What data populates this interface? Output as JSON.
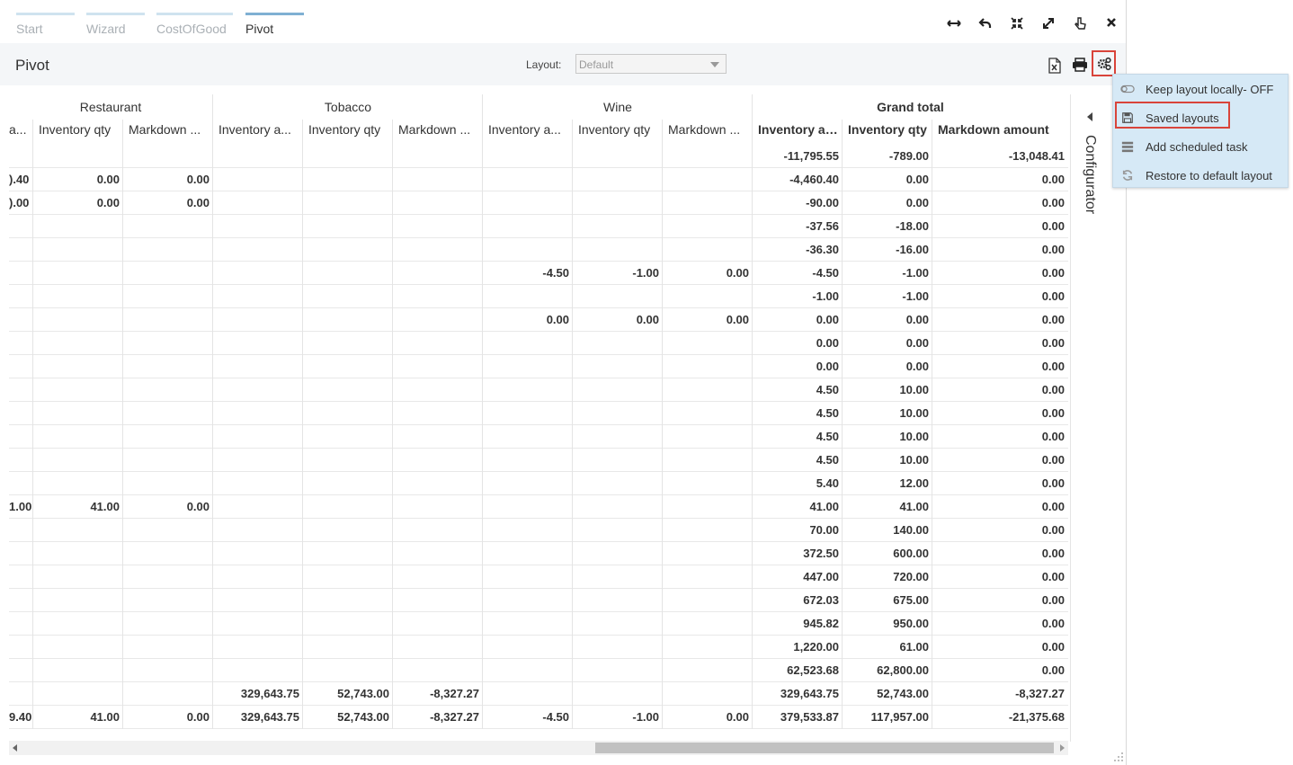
{
  "tabs": [
    {
      "label": "Start"
    },
    {
      "label": "Wizard"
    },
    {
      "label": "CostOfGood"
    },
    {
      "label": "Pivot"
    }
  ],
  "window_buttons": [
    "resize-horizontal-icon",
    "undo-icon",
    "shrink-icon",
    "expand-icon",
    "pointer-icon",
    "close-icon"
  ],
  "toolbar": {
    "title": "Pivot",
    "layout_label": "Layout:",
    "layout_value": "Default"
  },
  "columns": {
    "groups": [
      "Restaurant",
      "Tobacco",
      "Wine",
      "Grand total"
    ],
    "sub": [
      "a...",
      "Inventory qty",
      "Markdown ...",
      "Inventory a...",
      "Inventory qty",
      "Markdown ...",
      "Inventory a...",
      "Inventory qty",
      "Markdown ...",
      "Inventory amo",
      "Inventory qty",
      "Markdown amount"
    ]
  },
  "rows": [
    [
      "",
      "",
      "",
      "",
      "",
      "",
      "",
      "",
      "",
      "-11,795.55",
      "-789.00",
      "-13,048.41"
    ],
    [
      ").40",
      "0.00",
      "0.00",
      "",
      "",
      "",
      "",
      "",
      "",
      "-4,460.40",
      "0.00",
      "0.00"
    ],
    [
      ").00",
      "0.00",
      "0.00",
      "",
      "",
      "",
      "",
      "",
      "",
      "-90.00",
      "0.00",
      "0.00"
    ],
    [
      "",
      "",
      "",
      "",
      "",
      "",
      "",
      "",
      "",
      "-37.56",
      "-18.00",
      "0.00"
    ],
    [
      "",
      "",
      "",
      "",
      "",
      "",
      "",
      "",
      "",
      "-36.30",
      "-16.00",
      "0.00"
    ],
    [
      "",
      "",
      "",
      "",
      "",
      "",
      "-4.50",
      "-1.00",
      "0.00",
      "-4.50",
      "-1.00",
      "0.00"
    ],
    [
      "",
      "",
      "",
      "",
      "",
      "",
      "",
      "",
      "",
      "-1.00",
      "-1.00",
      "0.00"
    ],
    [
      "",
      "",
      "",
      "",
      "",
      "",
      "0.00",
      "0.00",
      "0.00",
      "0.00",
      "0.00",
      "0.00"
    ],
    [
      "",
      "",
      "",
      "",
      "",
      "",
      "",
      "",
      "",
      "0.00",
      "0.00",
      "0.00"
    ],
    [
      "",
      "",
      "",
      "",
      "",
      "",
      "",
      "",
      "",
      "0.00",
      "0.00",
      "0.00"
    ],
    [
      "",
      "",
      "",
      "",
      "",
      "",
      "",
      "",
      "",
      "4.50",
      "10.00",
      "0.00"
    ],
    [
      "",
      "",
      "",
      "",
      "",
      "",
      "",
      "",
      "",
      "4.50",
      "10.00",
      "0.00"
    ],
    [
      "",
      "",
      "",
      "",
      "",
      "",
      "",
      "",
      "",
      "4.50",
      "10.00",
      "0.00"
    ],
    [
      "",
      "",
      "",
      "",
      "",
      "",
      "",
      "",
      "",
      "4.50",
      "10.00",
      "0.00"
    ],
    [
      "",
      "",
      "",
      "",
      "",
      "",
      "",
      "",
      "",
      "5.40",
      "12.00",
      "0.00"
    ],
    [
      "1.00",
      "41.00",
      "0.00",
      "",
      "",
      "",
      "",
      "",
      "",
      "41.00",
      "41.00",
      "0.00"
    ],
    [
      "",
      "",
      "",
      "",
      "",
      "",
      "",
      "",
      "",
      "70.00",
      "140.00",
      "0.00"
    ],
    [
      "",
      "",
      "",
      "",
      "",
      "",
      "",
      "",
      "",
      "372.50",
      "600.00",
      "0.00"
    ],
    [
      "",
      "",
      "",
      "",
      "",
      "",
      "",
      "",
      "",
      "447.00",
      "720.00",
      "0.00"
    ],
    [
      "",
      "",
      "",
      "",
      "",
      "",
      "",
      "",
      "",
      "672.03",
      "675.00",
      "0.00"
    ],
    [
      "",
      "",
      "",
      "",
      "",
      "",
      "",
      "",
      "",
      "945.82",
      "950.00",
      "0.00"
    ],
    [
      "",
      "",
      "",
      "",
      "",
      "",
      "",
      "",
      "",
      "1,220.00",
      "61.00",
      "0.00"
    ],
    [
      "",
      "",
      "",
      "",
      "",
      "",
      "",
      "",
      "",
      "62,523.68",
      "62,800.00",
      "0.00"
    ],
    [
      "",
      "",
      "",
      "329,643.75",
      "52,743.00",
      "-8,327.27",
      "",
      "",
      "",
      "329,643.75",
      "52,743.00",
      "-8,327.27"
    ],
    [
      "9.40",
      "41.00",
      "0.00",
      "329,643.75",
      "52,743.00",
      "-8,327.27",
      "-4.50",
      "-1.00",
      "0.00",
      "379,533.87",
      "117,957.00",
      "-21,375.68"
    ]
  ],
  "configurator_label": "Configurator",
  "menu": {
    "items": [
      {
        "label": "Keep layout locally- OFF",
        "icon": "toggle-off-icon"
      },
      {
        "label": "Saved layouts",
        "icon": "floppy-disk-icon"
      },
      {
        "label": "Add scheduled task",
        "icon": "list-icon"
      },
      {
        "label": "Restore to default layout",
        "icon": "refresh-icon"
      }
    ]
  },
  "colors": {
    "accent": "#7fb0d3",
    "highlight": "#d9443a",
    "menu_bg": "#d6e9f6"
  }
}
